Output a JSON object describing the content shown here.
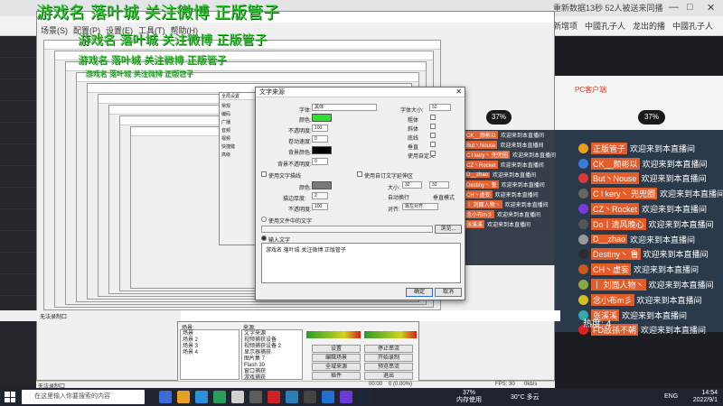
{
  "watermark": {
    "line1": "游戏名 落叶城  关注微博  正版管子",
    "line2": "游戏名 落叶城  关注微博  正版管子",
    "line3": "游戏名 落叶城  关注微博  正版管子",
    "line4": "游戏名 落叶城  关注微博  正版管子",
    "color": "#2ecc2e"
  },
  "browser": {
    "menu": [
      "场景(S)",
      "配置(P)",
      "设置(E)",
      "工具(T)",
      "帮助(H)"
    ],
    "right_tab": "重新数据13秒 52人被送来同播",
    "bookmarks": [
      "新增项",
      "中國孔子人",
      "龙出的播",
      "中國孔子人"
    ],
    "window_controls": [
      "—",
      "□",
      "✕"
    ]
  },
  "dialog": {
    "title": "文字来源",
    "close": "✕",
    "font_label": "字体:",
    "font_value": "黑体",
    "font_size_label": "字体大小:",
    "font_size_value": "52",
    "color_label": "颜色:",
    "color_value": "#29e22f",
    "opacity_label": "不透明度:",
    "opacity_value": "100",
    "scroll_label": "卷动速度:",
    "scroll_value": "0",
    "bgcolor_label": "背景颜色:",
    "bgcolor_value": "#000000",
    "bg_opacity_label": "背景不透明度:",
    "bg_opacity_value": "0",
    "bold": "粗体",
    "italic": "斜体",
    "underline": "底线",
    "vertical": "垂直",
    "outline_checkbox": "使用文字描线",
    "custom_box_checkbox": "使用自订文字延伸区",
    "outline_color_label": "颜色:",
    "outline_color_value": "#7a7a7a",
    "outline_thickness_label": "描边厚度:",
    "outline_thickness_value": "2",
    "outline_opacity_label": "不透明度:",
    "outline_opacity_value": "100",
    "size_label": "大小:",
    "size_w": "32",
    "size_h": "32",
    "auto_wrap": "自动换行",
    "vertical_wrap": "垂直模式",
    "align_label": "对齐:",
    "align_value": "靠左对齐",
    "use_file_radio": "使用文件中的文字",
    "browse": "浏览...",
    "input_text_radio": "输入文字",
    "text_value": "游戏名 落叶城  关注微博  正版管子",
    "ok": "确定",
    "cancel": "取消",
    "use_custom_color": "使用自定义"
  },
  "back_dialog": {
    "title": "全局设置",
    "items": [
      "常规",
      "编码",
      "广播",
      "音频",
      "视频",
      "快捷键",
      "高级"
    ]
  },
  "obs": {
    "scenes_label": "场景:",
    "scenes": [
      "场景",
      "场景 2",
      "场景 3",
      "场景 4"
    ],
    "sources_label": "来源:",
    "sources": [
      "文字来源",
      "视频捕获设备",
      "视频捕获设备 2",
      "显示器捕获",
      "图片集 7",
      "Flash 30",
      "窗口捕获",
      "游戏捕获"
    ],
    "buttons": [
      "设置",
      "停止串流",
      "编辑场景",
      "开始录制",
      "全域来源",
      "预览串流",
      "插件",
      "退出"
    ],
    "status": [
      "00:00",
      "0 (0.00%)",
      "FPS: 30",
      "0kb/s"
    ],
    "strip_labels": [
      "无法录制口",
      "无法录制口"
    ]
  },
  "stream": {
    "badge": "37%",
    "mid_badge": "37%",
    "top_label": "PC客户端",
    "heat_label": "热度:",
    "heat_value": "4"
  },
  "chat": [
    {
      "name": "正版管子",
      "msg": "欢迎来到本直播间",
      "color": "#e8a020"
    },
    {
      "name": "CK__颜彬以",
      "msg": "欢迎来到本直播间",
      "color": "#3a7bd5"
    },
    {
      "name": "But丶Nouse",
      "msg": "欢迎来到本直播间",
      "color": "#d83a3a"
    },
    {
      "name": "C l kery丶 兜兜圈",
      "msg": "欢迎来到本直播间",
      "color": "#666"
    },
    {
      "name": "CZ丶Rocket",
      "msg": "欢迎来到本直播间",
      "color": "#7c3ad8"
    },
    {
      "name": "Do丨清风晚心",
      "msg": "欢迎来到本直播间",
      "color": "#555"
    },
    {
      "name": "D__zhao",
      "msg": "欢迎来到本直播间",
      "color": "#999"
    },
    {
      "name": "Destiny丶 鲁",
      "msg": "欢迎来到本直播间",
      "color": "#2c2c2c"
    },
    {
      "name": "CH丶虚妄",
      "msg": "欢迎来到本直播间",
      "color": "#c85a20"
    },
    {
      "name": "丨 刘面人物丶",
      "msg": "欢迎来到本直播间",
      "color": "#8a4"
    },
    {
      "name": "念小布m彡",
      "msg": "欢迎来到本直播间",
      "color": "#d0c020"
    },
    {
      "name": "张溪溪",
      "msg": "欢迎来到本直播间",
      "color": "#3aa"
    },
    {
      "name": "FD敌孫不朝",
      "msg": "欢迎来到本直播间",
      "color": "#d22"
    }
  ],
  "taskbar": {
    "search_placeholder": "在这里输入你要搜索的内容",
    "memory_percent": "37%",
    "memory_label": "内存使用",
    "weather": "30°C 多云",
    "lang": "ENG",
    "time": "14:54",
    "date": "2022/9/1"
  }
}
